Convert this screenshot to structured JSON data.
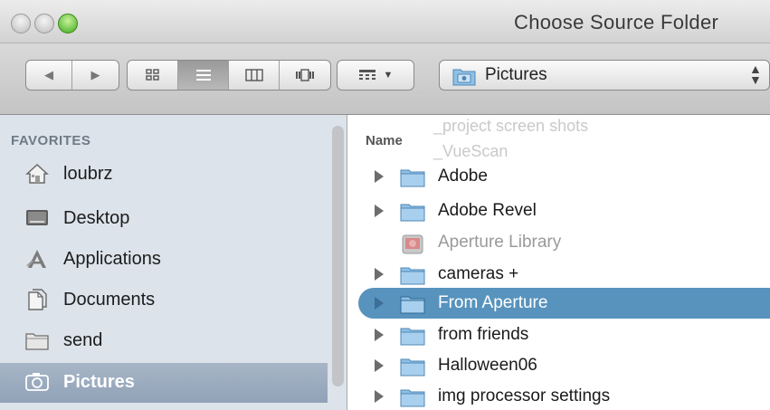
{
  "window": {
    "title": "Choose Source Folder"
  },
  "toolbar": {
    "path_popup": "Pictures",
    "nav": [
      {
        "icon": "back-arrow-icon"
      },
      {
        "icon": "forward-arrow-icon"
      }
    ],
    "views": [
      {
        "icon": "icon-view-icon",
        "active": false
      },
      {
        "icon": "list-view-icon",
        "active": true
      },
      {
        "icon": "column-view-icon",
        "active": false
      },
      {
        "icon": "cover-flow-icon",
        "active": false
      }
    ],
    "arrange_icon": "arrange-grid-icon"
  },
  "sidebar": {
    "heading": "FAVORITES",
    "items": [
      {
        "label": "loubrz",
        "icon": "home-icon",
        "selected": false
      },
      {
        "label": "Desktop",
        "icon": "desktop-icon",
        "selected": false
      },
      {
        "label": "Applications",
        "icon": "applications-icon",
        "selected": false
      },
      {
        "label": "Documents",
        "icon": "documents-icon",
        "selected": false
      },
      {
        "label": "send",
        "icon": "folder-icon",
        "selected": false
      },
      {
        "label": "Pictures",
        "icon": "camera-icon",
        "selected": true
      }
    ]
  },
  "list": {
    "column_header": "Name",
    "ghost_rows": [
      "_project screen shots",
      "_VueScan"
    ],
    "rows": [
      {
        "label": "Adobe",
        "type": "folder",
        "disclosure": true,
        "selected": false,
        "dim": false
      },
      {
        "label": "Adobe Revel",
        "type": "folder",
        "disclosure": true,
        "selected": false,
        "dim": false
      },
      {
        "label": "Aperture Library",
        "type": "library",
        "disclosure": false,
        "selected": false,
        "dim": true
      },
      {
        "label": "cameras +",
        "type": "folder",
        "disclosure": true,
        "selected": false,
        "dim": false
      },
      {
        "label": "From Aperture",
        "type": "folder",
        "disclosure": true,
        "selected": true,
        "dim": false
      },
      {
        "label": "from friends",
        "type": "folder",
        "disclosure": true,
        "selected": false,
        "dim": false
      },
      {
        "label": "Halloween06",
        "type": "folder",
        "disclosure": true,
        "selected": false,
        "dim": false
      },
      {
        "label": "img processor settings",
        "type": "folder",
        "disclosure": true,
        "selected": false,
        "dim": false
      }
    ]
  },
  "colors": {
    "selection": "#5893bd",
    "sidebar_bg": "#dde3ea",
    "sidebar_selected": "#9aaabf",
    "folder_blue": "#8fc0e6"
  }
}
